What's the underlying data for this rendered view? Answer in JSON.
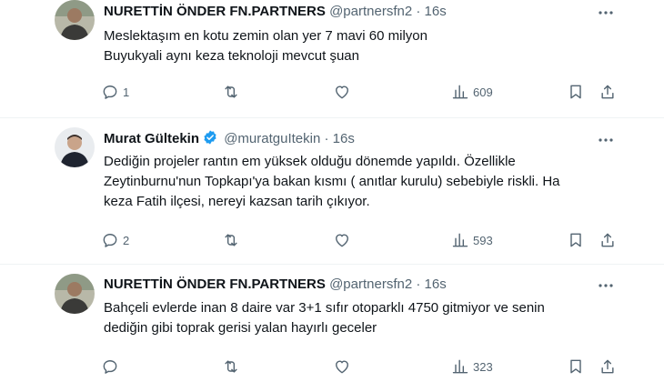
{
  "tweets": [
    {
      "name": "NURETTİN ÖNDER FN.PARTNERS",
      "handle": "@partnersfn2",
      "dot": "·",
      "time": "16s",
      "text": "Meslektaşım en kotu zemin olan yer 7 mavi 60 milyon\nBuyukyali aynı keza teknoloji mevcut şuan",
      "replies": "1",
      "retweets": "",
      "likes": "",
      "views": "609"
    },
    {
      "name": "Murat Gültekin",
      "handle": "@muratguItekin",
      "dot": "·",
      "time": "16s",
      "text": "Dediğin projeler rantın em yüksek olduğu dönemde yapıldı. Özellikle\nZeytinburnu'nun Topkapı'ya bakan kısmı ( anıtlar kurulu) sebebiyle riskli. Ha\nkeza Fatih ilçesi, nereyi kazsan tarih çıkıyor.",
      "replies": "2",
      "retweets": "",
      "likes": "",
      "views": "593"
    },
    {
      "name": "NURETTİN ÖNDER FN.PARTNERS",
      "handle": "@partnersfn2",
      "dot": "·",
      "time": "16s",
      "text": "Bahçeli evlerde inan 8 daire var 3+1 sıfır otoparklı 4750 gitmiyor  ve senin\ndediğin gibi toprak  gerisi yalan hayırlı geceler",
      "replies": "",
      "retweets": "",
      "likes": "",
      "views": "323"
    }
  ],
  "colors": {
    "text": "#0f1419",
    "muted": "#536471",
    "verified": "#1d9bf0",
    "divider": "#eff3f4"
  }
}
